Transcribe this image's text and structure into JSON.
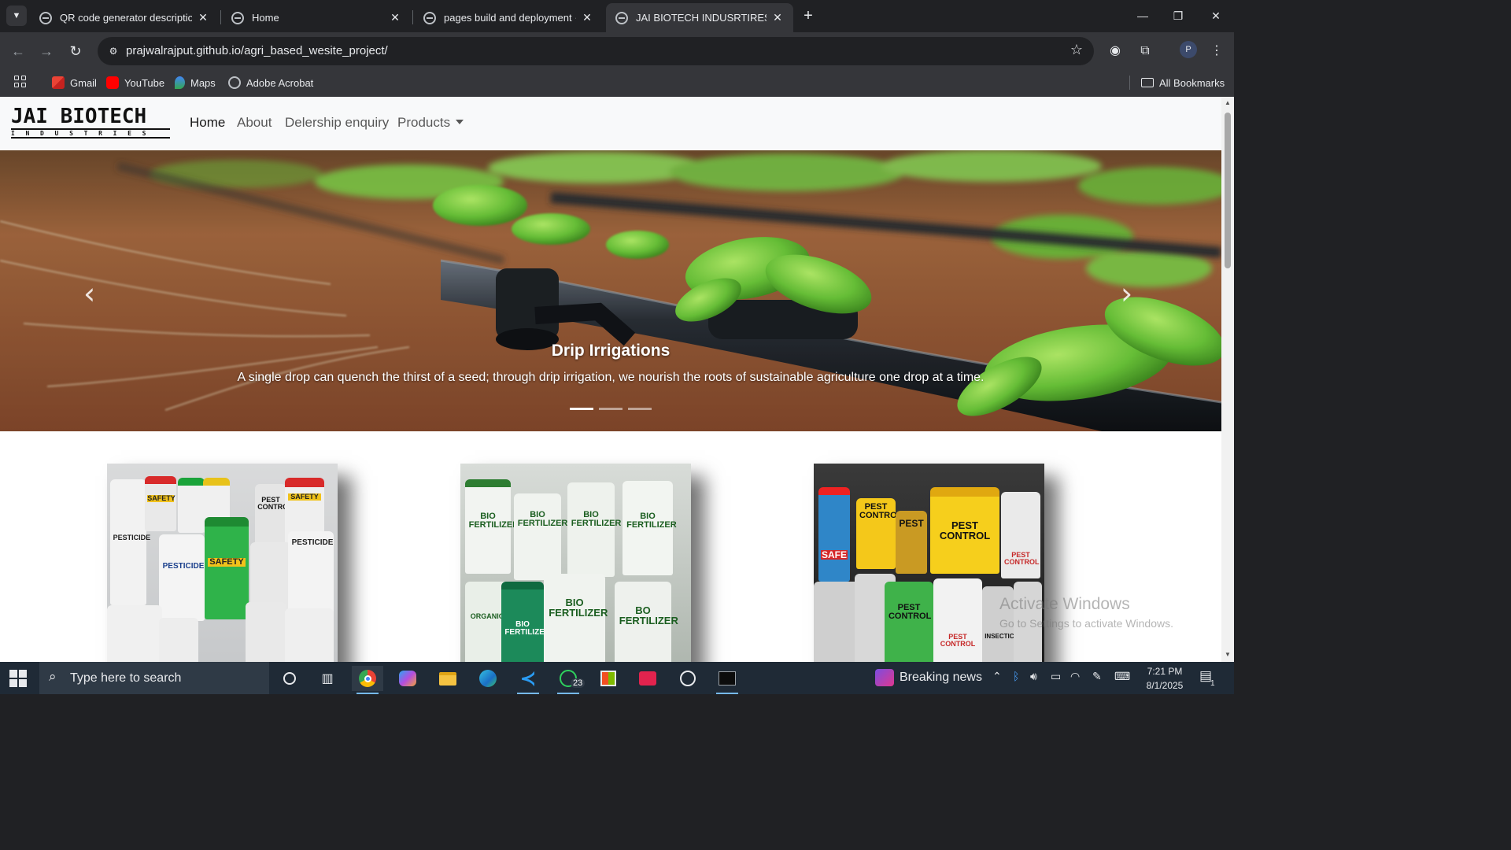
{
  "browser": {
    "tabs": [
      {
        "title": "QR code generator description",
        "active": false
      },
      {
        "title": "Home",
        "active": false
      },
      {
        "title": "pages build and deployment · p",
        "active": false
      },
      {
        "title": "JAI BIOTECH INDUSRTIRES",
        "active": true
      }
    ],
    "url": "prajwalrajput.github.io/agri_based_wesite_project/",
    "profile_initial": "P",
    "bookmarks": [
      "Gmail",
      "YouTube",
      "Maps",
      "Adobe Acrobat"
    ],
    "all_bookmarks": "All Bookmarks"
  },
  "site": {
    "logo": {
      "main": "JAI BIOTECH",
      "sub": "INDUSTRIES"
    },
    "nav": [
      "Home",
      "About",
      "Delership enquiry",
      "Products"
    ],
    "active_nav": "Home",
    "carousel": {
      "title": "Drip Irrigations",
      "text": "A single drop can quench the thirst of a seed; through drip irrigation, we nourish the roots of sustainable agriculture one drop at a time.",
      "prev": "‹",
      "next": "›",
      "slide_count": 3,
      "active_slide": 1
    },
    "cards": [
      {
        "labels": [
          "SAFETY",
          "PESTICIDE",
          "PEST CONTROL",
          "SAFETY",
          "PESTICIDE",
          "SAFETY",
          "PESTICIDE"
        ]
      },
      {
        "labels": [
          "BIO FERTILIZER",
          "BIO FERTILIZER",
          "BIO FERTILIZER",
          "BIO FERTILIZER",
          "BIO FERTILIZER",
          "BO FERTILIZER",
          "ORGANIC"
        ]
      },
      {
        "labels": [
          "PEST CONTROL",
          "PEST",
          "PEST CONTROL",
          "SAFE",
          "PEST CONTROL",
          "INSECTICIDE",
          "PEST CONTROL",
          "PEST CONTROL"
        ]
      }
    ]
  },
  "windows": {
    "watermark_title": "Activate Windows",
    "watermark_text": "Go to Settings to activate Windows.",
    "search_placeholder": "Type here to search",
    "whatsapp_badge": "23",
    "news": "Breaking news",
    "time": "7:21 PM",
    "date": "8/1/2025",
    "notification_count": "1"
  }
}
